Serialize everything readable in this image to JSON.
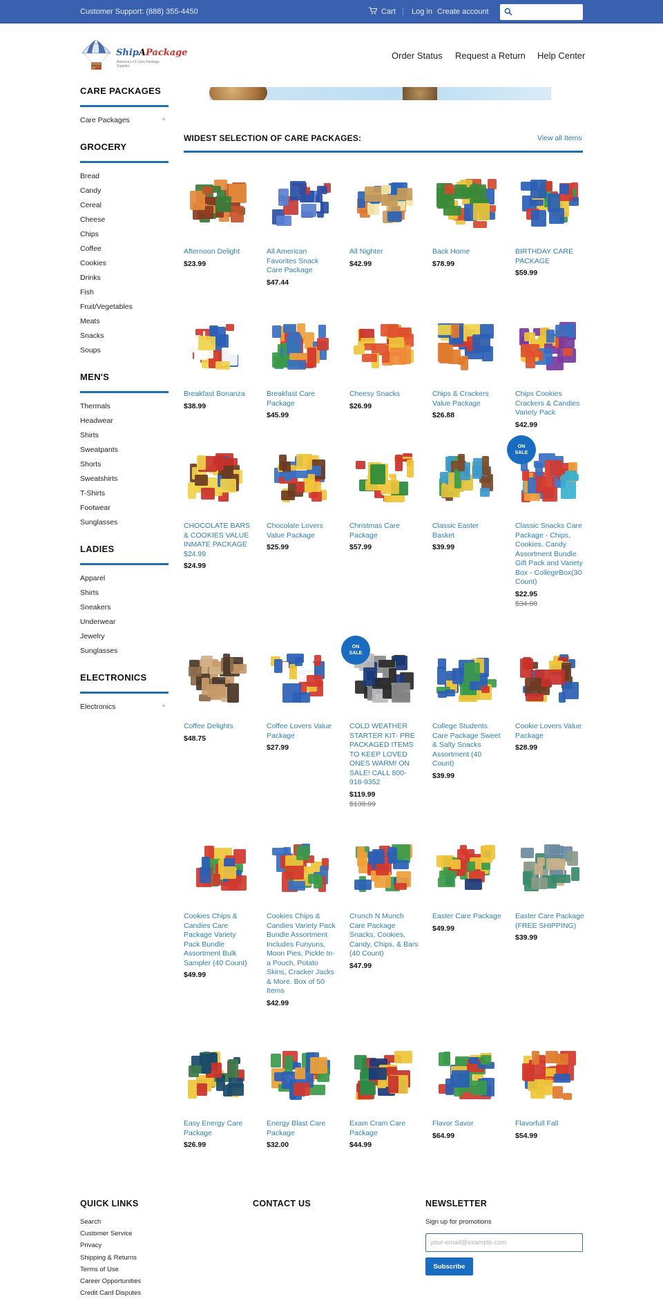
{
  "topbar": {
    "support": "Customer Support: (888) 355-4450",
    "cart_icon": "cart-icon",
    "cart": "Cart",
    "login": "Log in",
    "create_account": "Create account",
    "search_icon": "search-icon",
    "search_placeholder": ""
  },
  "header": {
    "logo_ship": "Ship",
    "logo_a": "A",
    "logo_package": "Package",
    "logo_tagline": "America's #1 Care Package Supplier",
    "nav": [
      "Order Status",
      "Request a Return",
      "Help Center"
    ]
  },
  "sidebar": [
    {
      "heading": "CARE PACKAGES",
      "items": [
        {
          "label": "Care Packages",
          "expand": "+"
        }
      ]
    },
    {
      "heading": "GROCERY",
      "items": [
        {
          "label": "Bread"
        },
        {
          "label": "Candy"
        },
        {
          "label": "Cereal"
        },
        {
          "label": "Cheese"
        },
        {
          "label": "Chips"
        },
        {
          "label": "Coffee"
        },
        {
          "label": "Cookies"
        },
        {
          "label": "Drinks"
        },
        {
          "label": "Fish"
        },
        {
          "label": "Fruit/Vegetables"
        },
        {
          "label": "Meats"
        },
        {
          "label": "Snacks"
        },
        {
          "label": "Soups"
        }
      ]
    },
    {
      "heading": "MEN'S",
      "items": [
        {
          "label": "Thermals"
        },
        {
          "label": "Headwear"
        },
        {
          "label": "Shirts"
        },
        {
          "label": "Sweatpants"
        },
        {
          "label": "Shorts"
        },
        {
          "label": "Sweatshirts"
        },
        {
          "label": "T-Shirts"
        },
        {
          "label": "Footwear"
        },
        {
          "label": "Sunglasses"
        }
      ]
    },
    {
      "heading": "LADIES",
      "items": [
        {
          "label": "Apparel"
        },
        {
          "label": "Shirts"
        },
        {
          "label": "Sneakers"
        },
        {
          "label": "Underwear"
        },
        {
          "label": "Jewelry"
        },
        {
          "label": "Sunglasses"
        }
      ]
    },
    {
      "heading": "ELECTRONICS",
      "items": [
        {
          "label": "Electronics",
          "expand": "+"
        }
      ]
    }
  ],
  "main": {
    "section_title": "WIDEST SELECTION OF CARE PACKAGES:",
    "view_all": "View all Items",
    "sale_badge_line1": "ON",
    "sale_badge_line2": "SALE",
    "products": [
      {
        "title": "Afternoon Delight",
        "price": "$23.99"
      },
      {
        "title": "All American Favorites Snack Care Package",
        "price": "$47.44"
      },
      {
        "title": "All Nighter",
        "price": "$42.99"
      },
      {
        "title": "Back Home",
        "price": "$78.99"
      },
      {
        "title": "BIRTHDAY CARE PACKAGE",
        "price": "$59.99"
      },
      {
        "title": "Breakfast Bonanza",
        "price": "$38.99"
      },
      {
        "title": "Breakfast Care Package",
        "price": "$45.99"
      },
      {
        "title": "Cheesy Snacks",
        "price": "$26.99"
      },
      {
        "title": "Chips & Crackers Value Package",
        "price": "$26.88"
      },
      {
        "title": "Chips Cookies Crackers & Candies Variety Pack",
        "price": "$42.99"
      },
      {
        "title": "CHOCOLATE BARS & COOKIES VALUE INMATE PACKAGE $24.99",
        "price": "$24.99"
      },
      {
        "title": "Chocolate Lovers Value Package",
        "price": "$25.99"
      },
      {
        "title": "Christmas Care Package",
        "price": "$57.99"
      },
      {
        "title": "Classic Easter Basket",
        "price": "$39.99"
      },
      {
        "title": "Classic Snacks Care Package - Chips, Cookies, Candy Assortment Bundle Gift Pack and Variety Box - CollegeBox(30 Count)",
        "price": "$22.95",
        "compare_price": "$34.00",
        "on_sale": true
      },
      {
        "title": "Coffee Delights",
        "price": "$48.75"
      },
      {
        "title": "Coffee Lovers Value Package",
        "price": "$27.99"
      },
      {
        "title": "COLD WEATHER STARTER KIT- PRE PACKAGED ITEMS TO KEEP LOVED ONES WARM! ON SALE! CALL 800-918-9352",
        "price": "$119.99",
        "compare_price": "$139.99",
        "on_sale": true
      },
      {
        "title": "College Students Care Package Sweet & Salty Snacks Assortment (40 Count)",
        "price": "$39.99"
      },
      {
        "title": "Cookie Lovers Value Package",
        "price": "$28.99"
      },
      {
        "title": "Cookies Chips & Candies Care Package Variety Pack Bundle Assortment Bulk Sampler (40 Count)",
        "price": "$49.99"
      },
      {
        "title": "Cookies Chips & Candies Variety Pack Bundle Assortment Includes Funyuns, Moon Pies, Pickle In-a Pouch, Potato Skins, Cracker Jacks & More. Box of 50 Items",
        "price": "$42.99"
      },
      {
        "title": "Crunch N Munch Care Package Snacks, Cookies, Candy, Chips, & Bars (40 Count)",
        "price": "$47.99"
      },
      {
        "title": "Easter Care Package",
        "price": "$49.99"
      },
      {
        "title": "Easter Care Package (FREE SHIPPING)",
        "price": "$39.99"
      },
      {
        "title": "Easy Energy Care Package",
        "price": "$26.99"
      },
      {
        "title": "Energy Blast Care Package",
        "price": "$32.00"
      },
      {
        "title": "Exam Cram Care Package",
        "price": "$44.99"
      },
      {
        "title": "Flavor Savor",
        "price": "$64.99"
      },
      {
        "title": "Flavorfull Fall",
        "price": "$54.99"
      }
    ]
  },
  "footer": {
    "quick_links_heading": "QUICK LINKS",
    "quick_links": [
      "Search",
      "Customer Service",
      "Privacy",
      "Shipping & Returns",
      "Terms of Use",
      "Career Opportunities",
      "Credit Card Disputes"
    ],
    "contact_heading": "CONTACT US",
    "newsletter_heading": "NEWSLETTER",
    "newsletter_text": "Sign up for promotions",
    "email_placeholder": "your-email@example.com",
    "subscribe": "Subscribe"
  },
  "colors": {
    "topbar": "#3a60b0",
    "accent": "#1f6fb2",
    "link": "#2f7eb0",
    "sale_badge": "#1a6cc0"
  }
}
